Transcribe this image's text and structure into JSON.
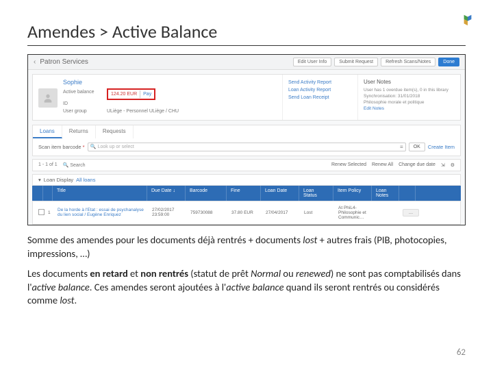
{
  "slide": {
    "title": "Amendes > Active Balance",
    "page_number": "62"
  },
  "header": {
    "section": "Patron Services",
    "buttons": {
      "edit": "Edit User Info",
      "submit": "Submit Request",
      "refresh": "Refresh Scans/Notes",
      "done": "Done"
    }
  },
  "user": {
    "name": "Sophie",
    "fields": {
      "balance_label": "Active balance",
      "id_label": "ID",
      "group_label": "User group",
      "group_value": "ULiège - Personnel ULiège / CHU"
    },
    "balance": {
      "amount": "124.20 EUR",
      "pay": "Pay"
    }
  },
  "actions": {
    "a1": "Send Activity Report",
    "a2": "Loan Activity Report",
    "a3": "Send Loan Receipt"
  },
  "notes": {
    "title": "User Notes",
    "line1": "User has 1 overdue item(s), 0 in this library",
    "line2": "Synchronisation: 31/01/2018",
    "line3": "Philosophie morale et politique",
    "edit": "Edit Notes"
  },
  "tabs": {
    "loans": "Loans",
    "returns": "Returns",
    "requests": "Requests"
  },
  "search": {
    "label": "Scan item barcode",
    "placeholder": "Look up or select",
    "ok": "OK",
    "create": "Create Item"
  },
  "results": {
    "count": "1 - 1 of 1",
    "search": "Search",
    "renew": "Renew Selected",
    "renew_all": "Renew All",
    "change": "Change due date"
  },
  "loan_display": {
    "label": "Loan Display",
    "value": "All loans"
  },
  "table": {
    "headers": {
      "title": "Title",
      "due": "Due Date ↓",
      "barcode": "Barcode",
      "fine": "Fine",
      "loan_date": "Loan Date",
      "status": "Loan Status",
      "policy": "Item Policy",
      "notes": "Loan Notes"
    },
    "row": {
      "num": "1",
      "title": "De la horde à l'Etat : essai de psychanalyse du lien social / Eugène Enriquez",
      "due": "27/02/2017 23:59:00",
      "barcode": "759730088",
      "fine": "37.80 EUR",
      "loan_date": "27/04/2017",
      "status": "Lost",
      "policy": "At PhiL4-Philosophie et Communic…",
      "more": "…"
    }
  },
  "caption": {
    "p1a": "Somme des amendes pour les documents déjà rentrés + documents ",
    "p1b": "lost",
    "p1c": " + autres frais (PIB, photocopies, impressions, …)",
    "p2a": "Les documents ",
    "p2b": "en retard",
    "p2c": " et ",
    "p2d": "non rentrés",
    "p2e": " (statut de prêt ",
    "p2f": "Normal",
    "p2g": " ou ",
    "p2h": "renewed",
    "p2i": ") ne sont pas comptabilisés dans l'",
    "p2j": "active balance",
    "p2k": ". Ces amendes seront ajoutées à l'",
    "p2l": "active balance",
    "p2m": " quand ils seront rentrés ou considérés comme ",
    "p2n": "lost",
    "p2o": "."
  }
}
